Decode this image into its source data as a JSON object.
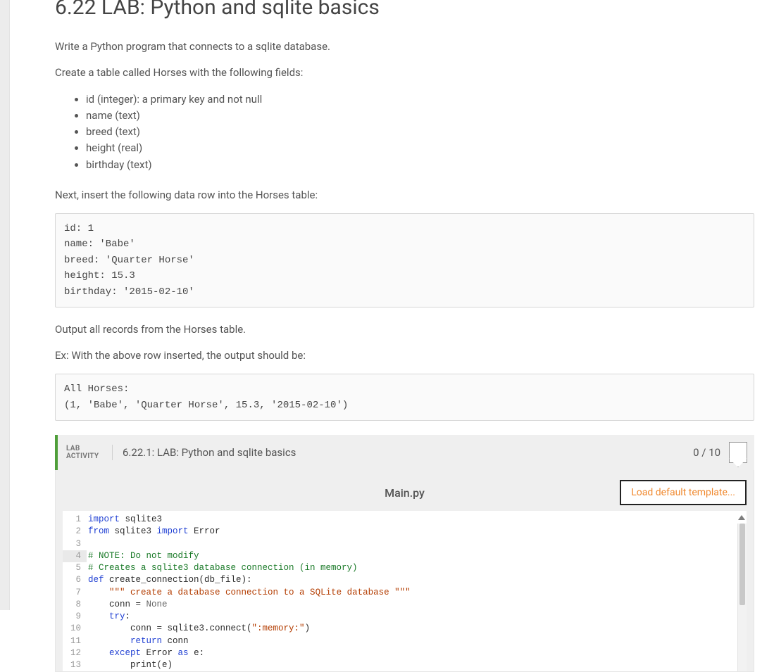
{
  "title": "6.22 LAB: Python and sqlite basics",
  "intro": "Write a Python program that connects to a sqlite database.",
  "create_intro": "Create a table called Horses with the following fields:",
  "fields": [
    "id (integer): a primary key and not null",
    "name (text)",
    "breed (text)",
    "height (real)",
    "birthday (text)"
  ],
  "insert_intro": "Next, insert the following data row into the Horses table:",
  "insert_block": "id: 1\nname: 'Babe'\nbreed: 'Quarter Horse'\nheight: 15.3\nbirthday: '2015-02-10'",
  "output_intro": "Output all records from the Horses table.",
  "example_intro": "Ex: With the above row inserted, the output should be:",
  "example_block": "All Horses:\n(1, 'Babe', 'Quarter Horse', 15.3, '2015-02-10')",
  "lab": {
    "tag_line1": "LAB",
    "tag_line2": "ACTIVITY",
    "name": "6.22.1: LAB: Python and sqlite basics",
    "score": "0 / 10"
  },
  "editor": {
    "filename": "Main.py",
    "load_btn": "Load default template...",
    "code_lines": [
      {
        "n": 1,
        "tokens": [
          [
            "kw",
            "import"
          ],
          [
            "",
            " sqlite3"
          ]
        ]
      },
      {
        "n": 2,
        "tokens": [
          [
            "kw",
            "from"
          ],
          [
            "",
            " sqlite3 "
          ],
          [
            "kw",
            "import"
          ],
          [
            "",
            " Error"
          ]
        ]
      },
      {
        "n": 3,
        "tokens": [
          [
            "",
            ""
          ]
        ]
      },
      {
        "n": 4,
        "hl": true,
        "tokens": [
          [
            "cm",
            "# NOTE: Do not modify"
          ]
        ]
      },
      {
        "n": 5,
        "tokens": [
          [
            "cm",
            "# Creates a sqlite3 database connection (in memory)"
          ]
        ]
      },
      {
        "n": 6,
        "tokens": [
          [
            "kw",
            "def"
          ],
          [
            "",
            " create_connection(db_file):"
          ]
        ]
      },
      {
        "n": 7,
        "tokens": [
          [
            "",
            "    "
          ],
          [
            "str",
            "\"\"\" create a database connection to a SQLite database \"\"\""
          ]
        ]
      },
      {
        "n": 8,
        "tokens": [
          [
            "",
            "    conn = "
          ],
          [
            "none",
            "None"
          ]
        ]
      },
      {
        "n": 9,
        "tokens": [
          [
            "",
            "    "
          ],
          [
            "kw",
            "try"
          ],
          [
            "",
            ":"
          ]
        ]
      },
      {
        "n": 10,
        "tokens": [
          [
            "",
            "        conn = sqlite3.connect("
          ],
          [
            "str",
            "\":memory:\""
          ],
          [
            "",
            ")"
          ]
        ]
      },
      {
        "n": 11,
        "tokens": [
          [
            "",
            "        "
          ],
          [
            "kw",
            "return"
          ],
          [
            "",
            " conn"
          ]
        ]
      },
      {
        "n": 12,
        "tokens": [
          [
            "",
            "    "
          ],
          [
            "kw",
            "except"
          ],
          [
            "",
            " Error "
          ],
          [
            "kw",
            "as"
          ],
          [
            "",
            " e:"
          ]
        ]
      },
      {
        "n": 13,
        "tokens": [
          [
            "",
            "        print(e)"
          ]
        ]
      }
    ]
  }
}
